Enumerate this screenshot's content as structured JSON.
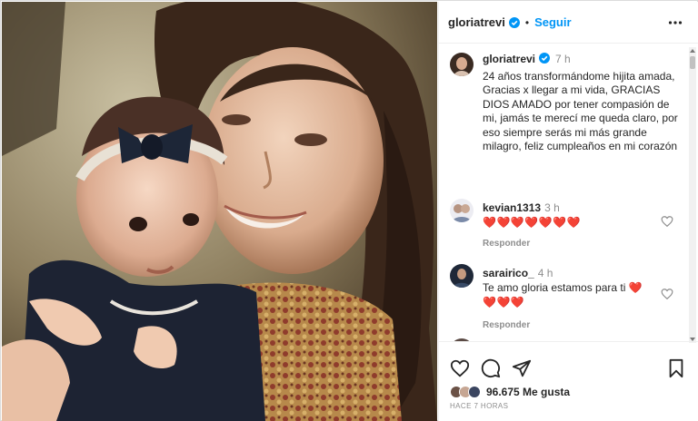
{
  "post": {
    "username": "gloriatrevi",
    "follow_label": "Seguir",
    "dot": "•"
  },
  "caption": {
    "username": "gloriatrevi",
    "time": "7 h",
    "text": "24 años transformándome hijita amada, Gracias x llegar a mi vida, GRACIAS DIOS AMADO por tener compasión de mi, jamás te merecí me queda claro, por eso siempre serás mi más grande milagro, feliz cumpleaños en mi corazón"
  },
  "comments": [
    {
      "username": "kevian1313",
      "time": "3 h",
      "text": "",
      "hearts": "❤️❤️❤️❤️❤️❤️❤️",
      "reply_label": "Responder"
    },
    {
      "username": "sarairico_",
      "time": "4 h",
      "text": "Te amo gloria estamos para ti",
      "hearts_inline": "❤️",
      "hearts": "❤️❤️❤️",
      "reply_label": "Responder"
    }
  ],
  "footer": {
    "likes_count": "96.675",
    "likes_label": "Me gusta",
    "ago": "HACE 7 HORAS"
  },
  "icons": {
    "verified": "verified-badge-icon",
    "more": "more-options-icon",
    "like": "heart-icon",
    "comment": "comment-icon",
    "share": "paper-plane-icon",
    "save": "bookmark-icon"
  },
  "colors": {
    "accent": "#0095f6",
    "heart": "#e0163b",
    "muted": "#8e8e8e"
  }
}
